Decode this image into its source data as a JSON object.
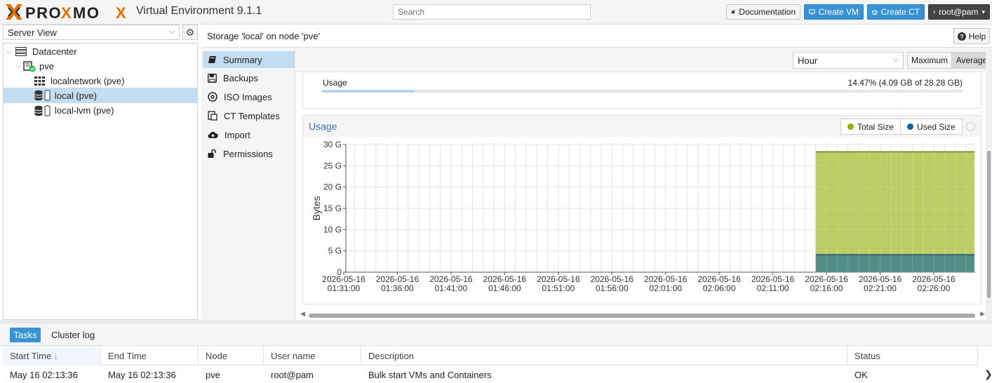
{
  "header": {
    "brand": "PROXMOX",
    "product": "Virtual Environment 9.1.1",
    "search_placeholder": "Search",
    "documentation_label": "Documentation",
    "create_vm_label": "Create VM",
    "create_ct_label": "Create CT",
    "user_label": "root@pam"
  },
  "sidebar": {
    "view_select": "Server View",
    "tree": [
      {
        "label": "Datacenter",
        "icon": "datacenter-icon"
      },
      {
        "label": "pve",
        "icon": "node-online-icon"
      },
      {
        "label": "localnetwork (pve)",
        "icon": "network-grid-icon"
      },
      {
        "label": "local (pve)",
        "icon": "storage-icon",
        "selected": true
      },
      {
        "label": "local-lvm (pve)",
        "icon": "storage-icon"
      }
    ]
  },
  "content": {
    "title": "Storage 'local' on node 'pve'",
    "help_label": "Help",
    "nav": [
      {
        "label": "Summary",
        "icon": "book-icon",
        "active": true
      },
      {
        "label": "Backups",
        "icon": "floppy-icon"
      },
      {
        "label": "ISO Images",
        "icon": "disc-icon"
      },
      {
        "label": "CT Templates",
        "icon": "template-icon"
      },
      {
        "label": "Import",
        "icon": "cloud-upload-icon"
      },
      {
        "label": "Permissions",
        "icon": "unlock-icon"
      }
    ],
    "timeframe": "Hour",
    "cf_buttons": {
      "maximum": "Maximum",
      "average": "Average",
      "selected": "Average"
    },
    "usage": {
      "label": "Usage",
      "value": "14.47% (4.09 GB of 28.28 GB)",
      "fraction": 0.1447
    }
  },
  "chart_data": {
    "type": "area",
    "title": "Usage",
    "ylabel": "Bytes",
    "xlabel": "",
    "y_tick_labels": [
      "0",
      "5 G",
      "10 G",
      "15 G",
      "20 G",
      "25 G",
      "30 G"
    ],
    "ylim": [
      0,
      30
    ],
    "x_tick_labels": [
      [
        "2026-05-16",
        "01:31:00"
      ],
      [
        "2026-05-16",
        "01:36:00"
      ],
      [
        "2026-05-16",
        "01:41:00"
      ],
      [
        "2026-05-16",
        "01:46:00"
      ],
      [
        "2026-05-16",
        "01:51:00"
      ],
      [
        "2026-05-16",
        "01:56:00"
      ],
      [
        "2026-05-16",
        "02:01:00"
      ],
      [
        "2026-05-16",
        "02:06:00"
      ],
      [
        "2026-05-16",
        "02:11:00"
      ],
      [
        "2026-05-16",
        "02:16:00"
      ],
      [
        "2026-05-16",
        "02:21:00"
      ],
      [
        "2026-05-16",
        "02:26:00"
      ]
    ],
    "legend_position": "top-right",
    "grid": true,
    "series": [
      {
        "name": "Total Size",
        "color": "#94ae0a",
        "data_start": "2026-05-16 02:15:00",
        "data_end": "2026-05-16 02:31:00",
        "value": 28.28
      },
      {
        "name": "Used Size",
        "color": "#115fa6",
        "data_start": "2026-05-16 02:15:00",
        "data_end": "2026-05-16 02:31:00",
        "value": 4.09
      }
    ]
  },
  "tasks": {
    "tab_tasks": "Tasks",
    "tab_cluster_log": "Cluster log",
    "columns": [
      "Start Time",
      "End Time",
      "Node",
      "User name",
      "Description",
      "Status"
    ],
    "sort_indicator": "↓",
    "rows": [
      [
        "May 16 02:13:36",
        "May 16 02:13:36",
        "pve",
        "root@pam",
        "Bulk start VMs and Containers",
        "OK"
      ]
    ]
  }
}
